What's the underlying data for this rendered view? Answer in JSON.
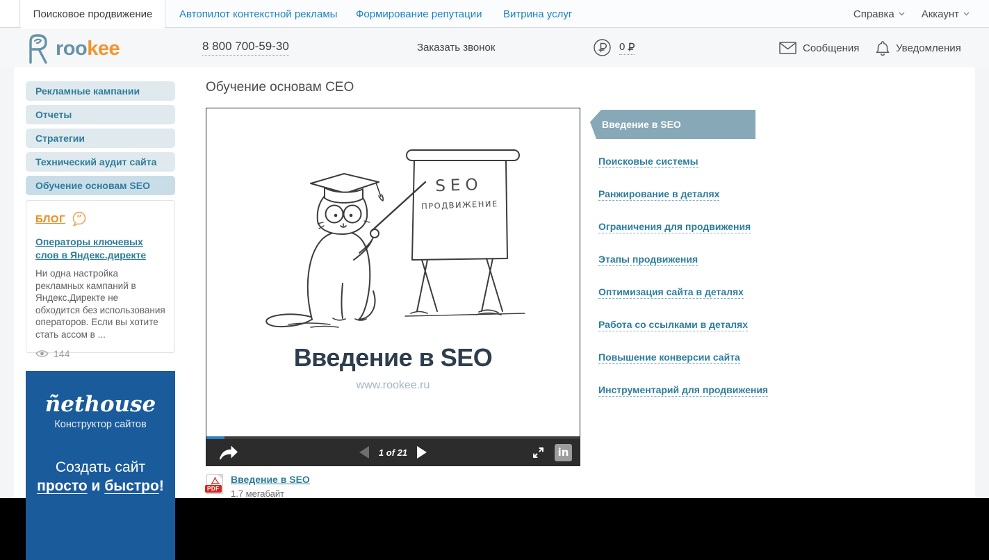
{
  "topbar": {
    "tabs": [
      {
        "label": "Поисковое продвижение",
        "active": true
      },
      {
        "label": "Автопилот контекстной рекламы",
        "active": false
      },
      {
        "label": "Формирование репутации",
        "active": false
      },
      {
        "label": "Витрина услуг",
        "active": false
      }
    ],
    "help": "Справка",
    "account": "Аккаунт"
  },
  "header": {
    "logo_teal": "roo",
    "logo_orange": "kee",
    "phone": "8 800 700-59-30",
    "order_call": "Заказать звонок",
    "balance_amount": "0",
    "messages": "Сообщения",
    "notifications": "Уведомления"
  },
  "sidebar": {
    "items": [
      "Рекламные кампании",
      "Отчеты",
      "Стратегии",
      "Технический аудит сайта",
      "Обучение основам SEO"
    ],
    "blog": {
      "title": "БЛОГ",
      "article_title": "Операторы ключевых слов в Яндекс.директе",
      "excerpt": "Ни одна настройка рекламных кампаний в Яндекс.Директе не обходится без использования операторов. Если вы хотите стать ассом в ...",
      "views": "144"
    },
    "banner": {
      "brand": "ñethouse",
      "subtitle": "Конструктор сайтов",
      "line1": "Создать сайт",
      "word1": "просто",
      "mid": " и ",
      "word2": "быстро",
      "end": "!"
    }
  },
  "content": {
    "title": "Обучение основам СЕО",
    "slide": {
      "board_line1": "SEO",
      "board_line2": "ПРОДВИЖЕНИЕ",
      "title": "Введение в SEO",
      "url": "www.rookee.ru"
    },
    "player": {
      "page_indicator": "1 of 21",
      "linkedin": "in"
    },
    "pdf": {
      "label": "PDF",
      "link": "Введение в SEO",
      "size": "1.7 мегабайт"
    }
  },
  "lessons": {
    "active": "Введение в SEO",
    "items": [
      "Поисковые системы",
      "Ранжирование в деталях",
      "Ограничения для продвижения",
      "Этапы продвижения",
      "Оптимизация сайта в деталях",
      "Работа со ссылками в деталях",
      "Повышение конверсии сайта",
      "Инструментарий для продвижения"
    ]
  },
  "colors": {
    "accent_teal": "#2d7d9c",
    "accent_orange": "#ee8b1f",
    "link_blue": "#1e82c6",
    "banner_blue": "#1a5b9c",
    "ribbon": "#87a9b7",
    "player_bar": "#2c2c2c",
    "progress_blue": "#2e80c2"
  }
}
